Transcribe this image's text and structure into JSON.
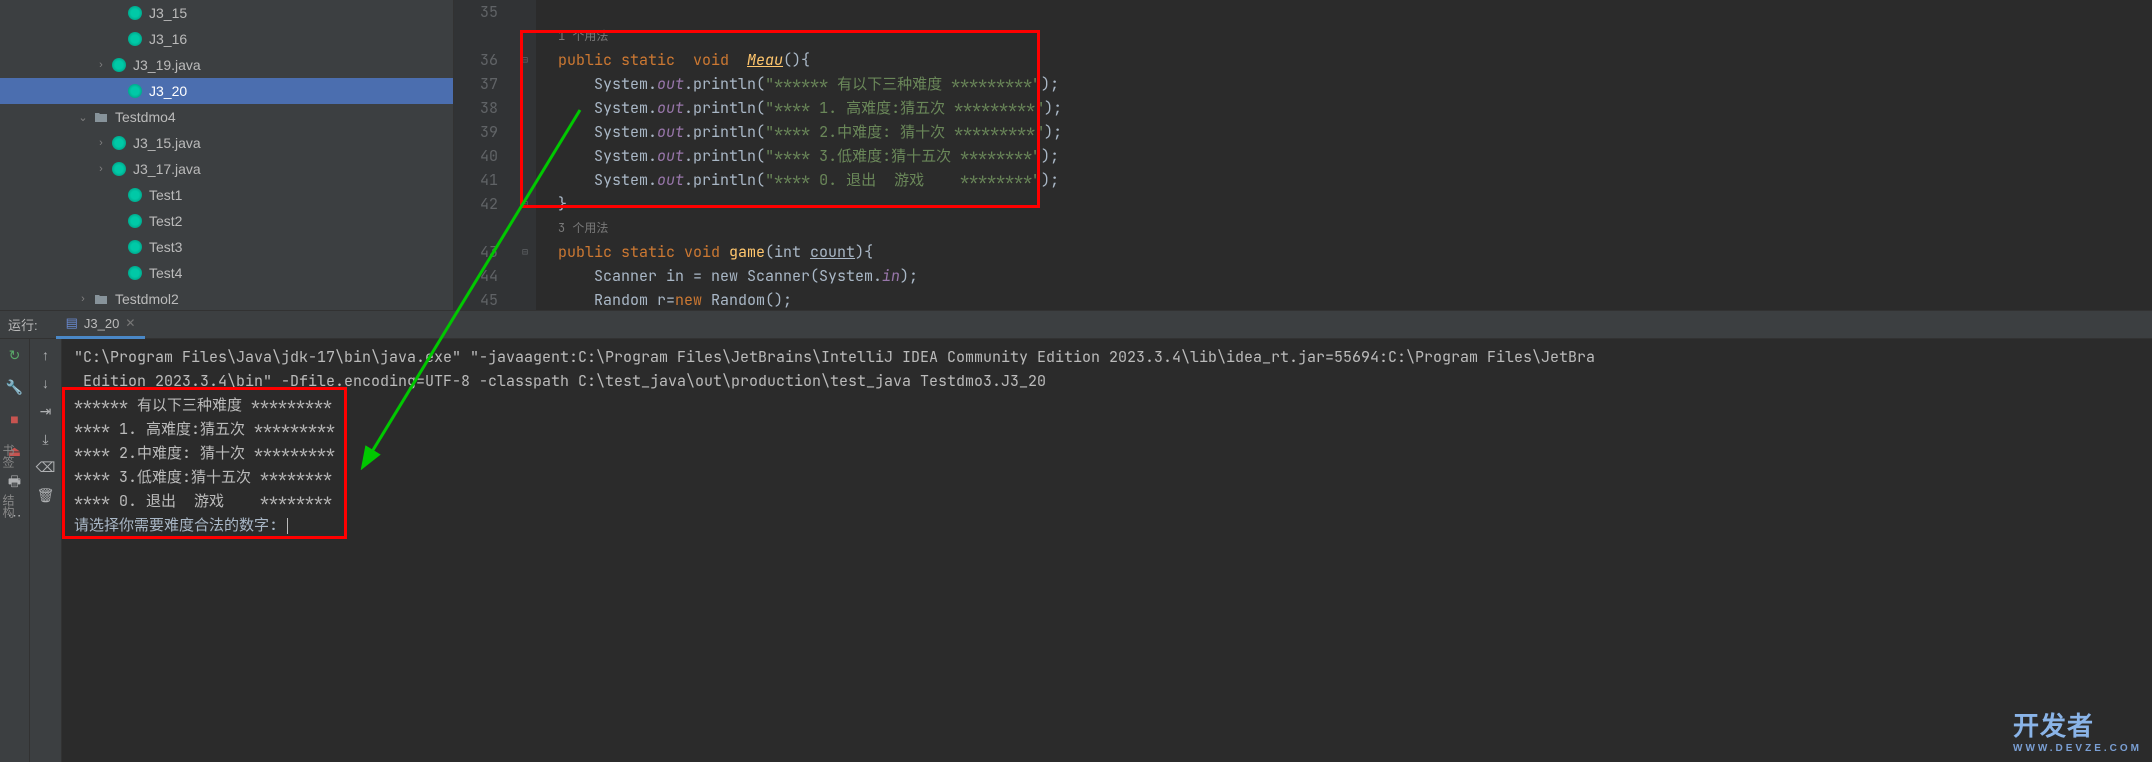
{
  "tree": {
    "items": [
      {
        "indent": 110,
        "chev": "",
        "icon": "java",
        "label": "J3_15"
      },
      {
        "indent": 110,
        "chev": "",
        "icon": "java",
        "label": "J3_16"
      },
      {
        "indent": 94,
        "chev": "›",
        "icon": "java",
        "label": "J3_19.java"
      },
      {
        "indent": 110,
        "chev": "",
        "icon": "java",
        "label": "J3_20",
        "selected": true
      },
      {
        "indent": 76,
        "chev": "⌄",
        "icon": "folder",
        "label": "Testdmo4"
      },
      {
        "indent": 94,
        "chev": "›",
        "icon": "java",
        "label": "J3_15.java"
      },
      {
        "indent": 94,
        "chev": "›",
        "icon": "java",
        "label": "J3_17.java"
      },
      {
        "indent": 110,
        "chev": "",
        "icon": "java",
        "label": "Test1"
      },
      {
        "indent": 110,
        "chev": "",
        "icon": "java",
        "label": "Test2"
      },
      {
        "indent": 110,
        "chev": "",
        "icon": "java",
        "label": "Test3"
      },
      {
        "indent": 110,
        "chev": "",
        "icon": "java",
        "label": "Test4"
      },
      {
        "indent": 76,
        "chev": "›",
        "icon": "folder",
        "label": "Testdmol2"
      }
    ]
  },
  "editor": {
    "lines": [
      "35",
      "36",
      "37",
      "38",
      "39",
      "40",
      "41",
      "42",
      "",
      "43",
      "44",
      "45"
    ],
    "usage1": "1 个用法",
    "usage2": "3 个用法",
    "code": {
      "l36_pre": "public static  void  ",
      "l36_method": "Meau",
      "l36_post": "(){",
      "sys": "System.",
      "out": "out",
      "println": ".println(",
      "s1": "\"****** 有以下三种难度 *********\"",
      "s2": "\"**** 1. 高难度:猜五次 *********\"",
      "s3": "\"**** 2.中难度: 猜十次 *********\"",
      "s4": "\"**** 3.低难度:猜十五次 ********\"",
      "s5": "\"**** 0. 退出  游戏    ********\"",
      "end": ");",
      "brace": "}",
      "l43_a": "public static void ",
      "l43_m": "game",
      "l43_b": "(int ",
      "l43_p": "count",
      "l43_c": "){",
      "l44": "    Scanner in = new Scanner(System.",
      "l44_in": "in",
      "l44_end": ");",
      "l45_a": "    Random r=",
      "l45_new": "new",
      "l45_b": " Random();"
    }
  },
  "run": {
    "label": "运行:",
    "tab": "J3_20",
    "cmd1": "\"C:\\Program Files\\Java\\jdk-17\\bin\\java.exe\" \"-javaagent:C:\\Program Files\\JetBrains\\IntelliJ IDEA Community Edition 2023.3.4\\lib\\idea_rt.jar=55694:C:\\Program Files\\JetBra",
    "cmd2": " Edition 2023.3.4\\bin\" -Dfile.encoding=UTF-8 -classpath C:\\test_java\\out\\production\\test_java Testdmo3.J3_20",
    "o1": "****** 有以下三种难度 *********",
    "o2": "**** 1. 高难度:猜五次 *********",
    "o3": "**** 2.中难度: 猜十次 *********",
    "o4": "**** 3.低难度:猜十五次 ********",
    "o5": "**** 0. 退出  游戏    ********",
    "prompt": "请选择你需要难度合法的数字: "
  },
  "sideLabels": {
    "a": "书签",
    "b": "结构"
  },
  "watermark": {
    "main": "开发者",
    "sub": "WWW.DEVZE.COM"
  }
}
